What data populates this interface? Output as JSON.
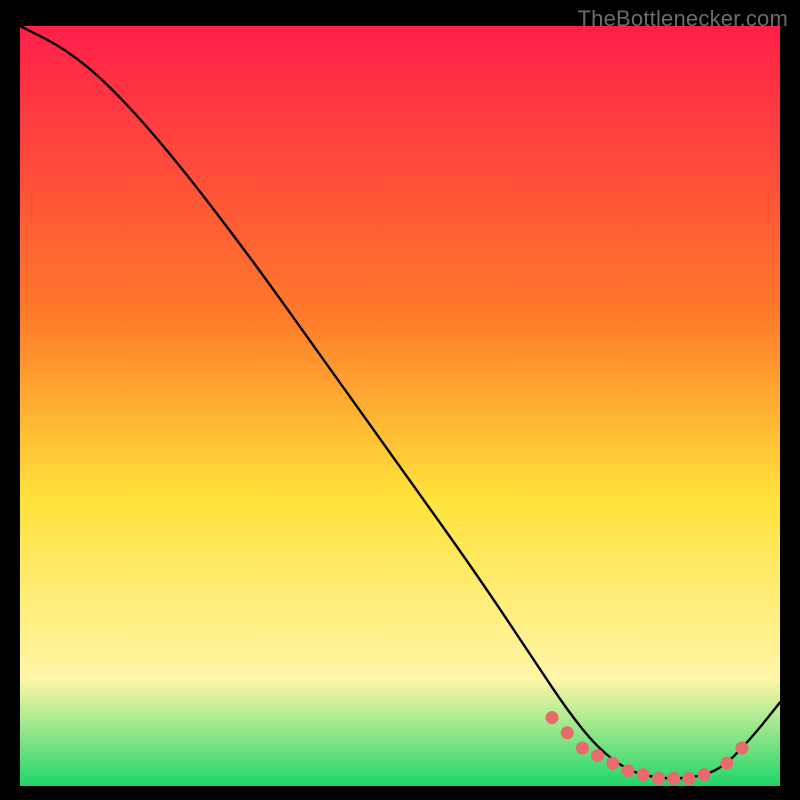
{
  "watermark": "TheBottlenecker.com",
  "colors": {
    "frame": "#000000",
    "bg_top": "#ff1f4a",
    "bg_mid1": "#ff7a2a",
    "bg_mid2": "#ffe23a",
    "bg_low": "#fff6a8",
    "bg_bottom": "#1fd66a",
    "curve": "#000000",
    "markers": "#e86a6a"
  },
  "chart_data": {
    "type": "line",
    "title": "",
    "xlabel": "",
    "ylabel": "",
    "xlim": [
      0,
      100
    ],
    "ylim": [
      0,
      100
    ],
    "series": [
      {
        "name": "bottleneck-curve",
        "x": [
          0,
          6,
          12,
          20,
          30,
          40,
          50,
          60,
          68,
          72,
          76,
          80,
          84,
          88,
          92,
          96,
          100
        ],
        "y": [
          100,
          97,
          92,
          83,
          70,
          56,
          42,
          28,
          16,
          10,
          5,
          2,
          1,
          1,
          2,
          6,
          11
        ]
      }
    ],
    "markers": {
      "name": "highlight-points",
      "x": [
        70,
        72,
        74,
        76,
        78,
        80,
        82,
        84,
        86,
        88,
        90,
        93,
        95
      ],
      "y": [
        9,
        7,
        5,
        4,
        3,
        2,
        1.5,
        1,
        1,
        1,
        1.5,
        3,
        5
      ]
    }
  }
}
